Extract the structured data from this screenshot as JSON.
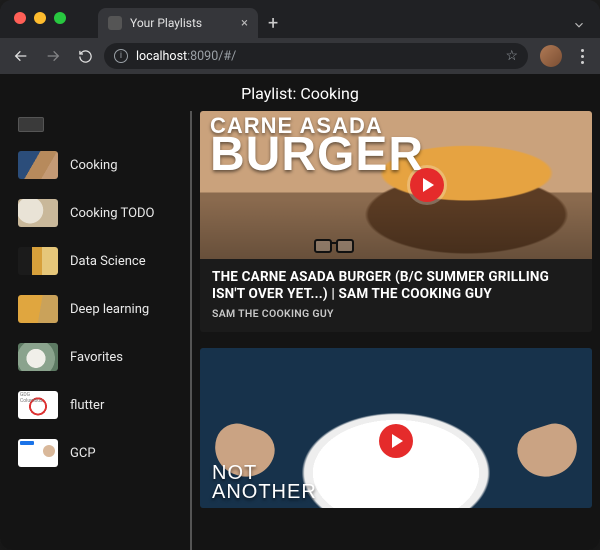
{
  "browser": {
    "tab_title": "Your Playlists",
    "url_host": "localhost",
    "url_port_path": ":8090/#/"
  },
  "page": {
    "title": "Playlist: Cooking"
  },
  "sidebar": {
    "items": [
      {
        "label": "Cooking"
      },
      {
        "label": "Cooking TODO"
      },
      {
        "label": "Data Science"
      },
      {
        "label": "Deep learning"
      },
      {
        "label": "Favorites"
      },
      {
        "label": "flutter"
      },
      {
        "label": "GCP"
      }
    ]
  },
  "videos": [
    {
      "overlay_line1": "CARNE ASADA",
      "overlay_line2": "BURGER",
      "title": "THE CARNE ASADA BURGER (B/C SUMMER GRILLING ISN'T OVER YET...) | SAM THE COOKING GUY",
      "channel": "SAM THE COOKING GUY"
    },
    {
      "overlay_line1": "NOT",
      "overlay_line2": "ANOTHER"
    }
  ]
}
